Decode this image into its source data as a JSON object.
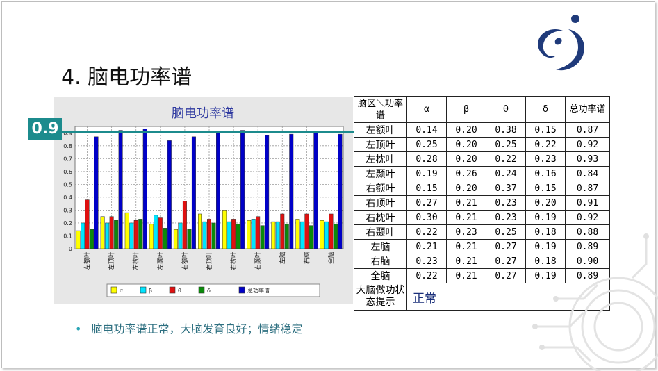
{
  "slide": {
    "title": "4. 脑电功率谱",
    "badge": "0.9",
    "bullet": "脑电功率谱正常，大脑发育良好；情绪稳定"
  },
  "colors": {
    "accent": "#1c8b8d",
    "bullet_text": "#2d6f80",
    "status": "#1a2f7a"
  },
  "table": {
    "header": {
      "region": "脑区＼功率谱",
      "alpha": "α",
      "beta": "β",
      "theta": "θ",
      "delta": "δ",
      "total": "总功率谱"
    },
    "rows": [
      {
        "region": "左额叶",
        "alpha": "0.14",
        "beta": "0.20",
        "theta": "0.38",
        "delta": "0.15",
        "total": "0.87"
      },
      {
        "region": "左顶叶",
        "alpha": "0.25",
        "beta": "0.20",
        "theta": "0.25",
        "delta": "0.22",
        "total": "0.92"
      },
      {
        "region": "左枕叶",
        "alpha": "0.28",
        "beta": "0.20",
        "theta": "0.22",
        "delta": "0.23",
        "total": "0.93"
      },
      {
        "region": "左颞叶",
        "alpha": "0.19",
        "beta": "0.26",
        "theta": "0.24",
        "delta": "0.16",
        "total": "0.84"
      },
      {
        "region": "右额叶",
        "alpha": "0.15",
        "beta": "0.20",
        "theta": "0.37",
        "delta": "0.15",
        "total": "0.87"
      },
      {
        "region": "右顶叶",
        "alpha": "0.27",
        "beta": "0.21",
        "theta": "0.23",
        "delta": "0.20",
        "total": "0.91"
      },
      {
        "region": "右枕叶",
        "alpha": "0.30",
        "beta": "0.21",
        "theta": "0.23",
        "delta": "0.19",
        "total": "0.92"
      },
      {
        "region": "右颞叶",
        "alpha": "0.22",
        "beta": "0.23",
        "theta": "0.25",
        "delta": "0.18",
        "total": "0.88"
      },
      {
        "region": "左脑",
        "alpha": "0.21",
        "beta": "0.21",
        "theta": "0.27",
        "delta": "0.19",
        "total": "0.89"
      },
      {
        "region": "右脑",
        "alpha": "0.23",
        "beta": "0.21",
        "theta": "0.27",
        "delta": "0.18",
        "total": "0.90"
      },
      {
        "region": "全脑",
        "alpha": "0.22",
        "beta": "0.21",
        "theta": "0.27",
        "delta": "0.19",
        "total": "0.89"
      }
    ],
    "status_label": "大脑做功状态提示",
    "status_value": "正常"
  },
  "chart_data": {
    "type": "bar",
    "title": "脑电功率谱",
    "categories": [
      "左额叶",
      "左顶叶",
      "左枕叶",
      "左颞叶",
      "右额叶",
      "右顶叶",
      "右枕叶",
      "右颞叶",
      "左脑",
      "右脑",
      "全脑"
    ],
    "series": [
      {
        "name": "α",
        "color": "#ffff00",
        "values": [
          0.14,
          0.25,
          0.28,
          0.19,
          0.15,
          0.27,
          0.3,
          0.22,
          0.21,
          0.23,
          0.22
        ]
      },
      {
        "name": "β",
        "color": "#00e5ff",
        "values": [
          0.2,
          0.2,
          0.2,
          0.26,
          0.2,
          0.21,
          0.21,
          0.23,
          0.21,
          0.21,
          0.21
        ]
      },
      {
        "name": "θ",
        "color": "#e01010",
        "values": [
          0.38,
          0.25,
          0.22,
          0.24,
          0.37,
          0.23,
          0.23,
          0.25,
          0.27,
          0.27,
          0.27
        ]
      },
      {
        "name": "δ",
        "color": "#0a8a0a",
        "values": [
          0.15,
          0.22,
          0.23,
          0.16,
          0.15,
          0.2,
          0.19,
          0.18,
          0.19,
          0.18,
          0.19
        ]
      },
      {
        "name": "总功率谱",
        "color": "#0000c8",
        "values": [
          0.87,
          0.92,
          0.93,
          0.84,
          0.87,
          0.91,
          0.92,
          0.88,
          0.89,
          0.9,
          0.89
        ]
      }
    ],
    "yticks": [
      "0",
      "0.1",
      "0.2",
      "0.3",
      "0.4",
      "0.5",
      "0.6",
      "0.7",
      "0.8",
      "0.9"
    ],
    "ylim": [
      0,
      0.95
    ],
    "grid": true,
    "legend": "bottom"
  }
}
